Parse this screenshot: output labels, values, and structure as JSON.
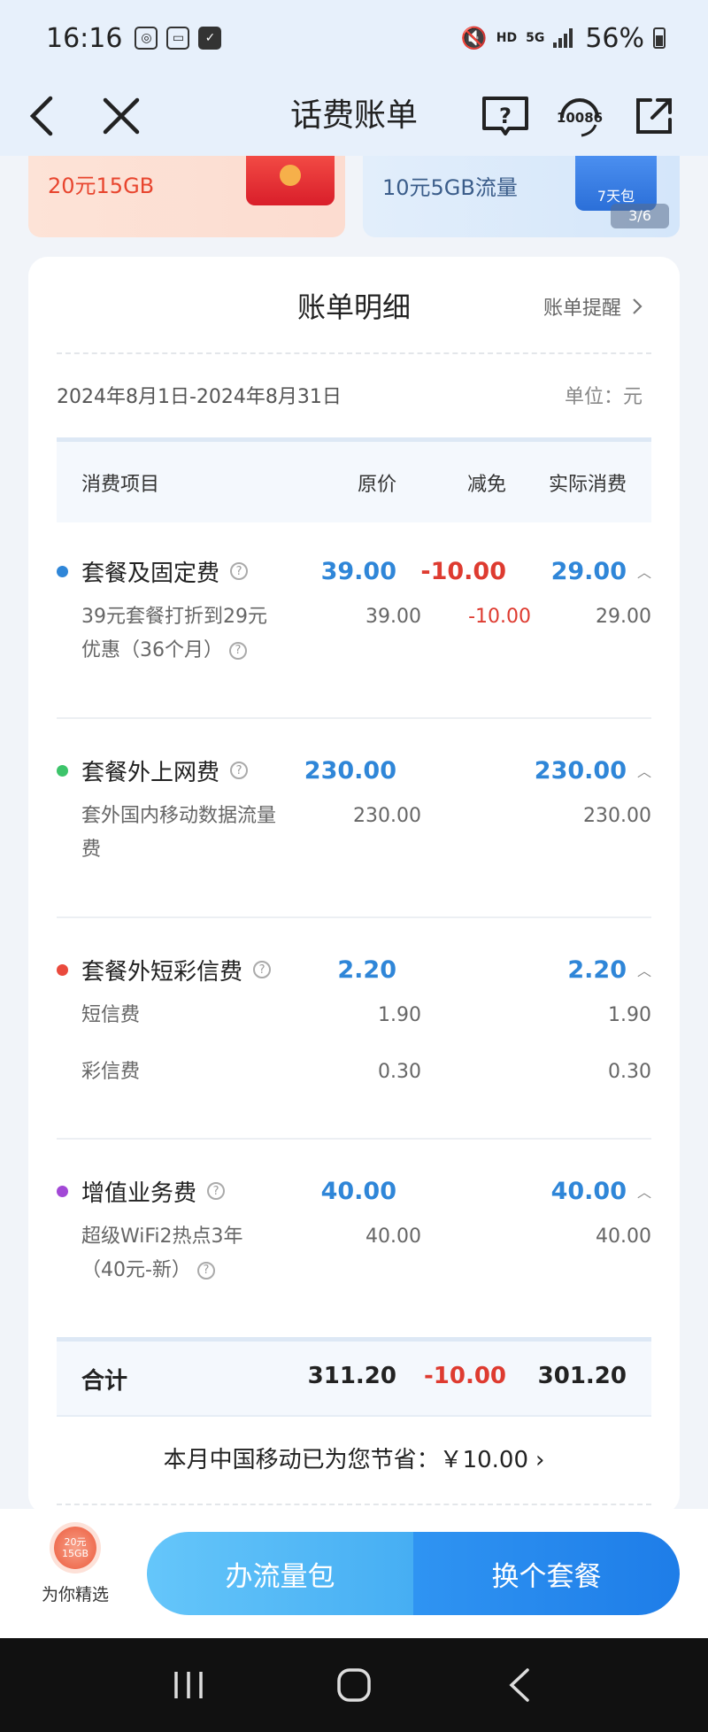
{
  "status_bar": {
    "time": "16:16",
    "network": "5G",
    "hd": "HD",
    "battery_pct": "56%"
  },
  "header": {
    "title": "话费账单",
    "hotline": "10086"
  },
  "banners": [
    {
      "text": "20元15GB"
    },
    {
      "text": "10元5GB流量",
      "tag": "7天包",
      "pager": "3/6"
    }
  ],
  "bill": {
    "title": "账单明细",
    "reminder_label": "账单提醒",
    "period": "2024年8月1日-2024年8月31日",
    "unit": "单位：元",
    "columns": [
      "消费项目",
      "原价",
      "减免",
      "实际消费"
    ],
    "sections": [
      {
        "name": "套餐及固定费",
        "color": "#2f86d8",
        "original": "39.00",
        "discount": "-10.00",
        "actual": "29.00",
        "items": [
          {
            "name": "39元套餐打折到29元优惠（36个月）",
            "original": "39.00",
            "discount": "-10.00",
            "actual": "29.00"
          }
        ]
      },
      {
        "name": "套餐外上网费",
        "color": "#3cc46a",
        "original": "230.00",
        "discount": "",
        "actual": "230.00",
        "items": [
          {
            "name": "套外国内移动数据流量费",
            "original": "230.00",
            "discount": "",
            "actual": "230.00"
          }
        ]
      },
      {
        "name": "套餐外短彩信费",
        "color": "#ea4a3d",
        "original": "2.20",
        "discount": "",
        "actual": "2.20",
        "items": [
          {
            "name": "短信费",
            "original": "1.90",
            "discount": "",
            "actual": "1.90"
          },
          {
            "name": "彩信费",
            "original": "0.30",
            "discount": "",
            "actual": "0.30"
          }
        ]
      },
      {
        "name": "增值业务费",
        "color": "#a248d6",
        "original": "40.00",
        "discount": "",
        "actual": "40.00",
        "items": [
          {
            "name": "超级WiFi2热点3年（40元-新）",
            "original": "40.00",
            "discount": "",
            "actual": "40.00"
          }
        ]
      }
    ],
    "total": {
      "label": "合计",
      "original": "311.20",
      "discount": "-10.00",
      "actual": "301.20"
    },
    "savings": "本月中国移动已为您节省：￥10.00"
  },
  "action_bar": {
    "pick_badge": [
      "20元",
      "15GB"
    ],
    "pick_label": "为你精选",
    "btn_data_pack": "办流量包",
    "btn_change_plan": "换个套餐"
  }
}
